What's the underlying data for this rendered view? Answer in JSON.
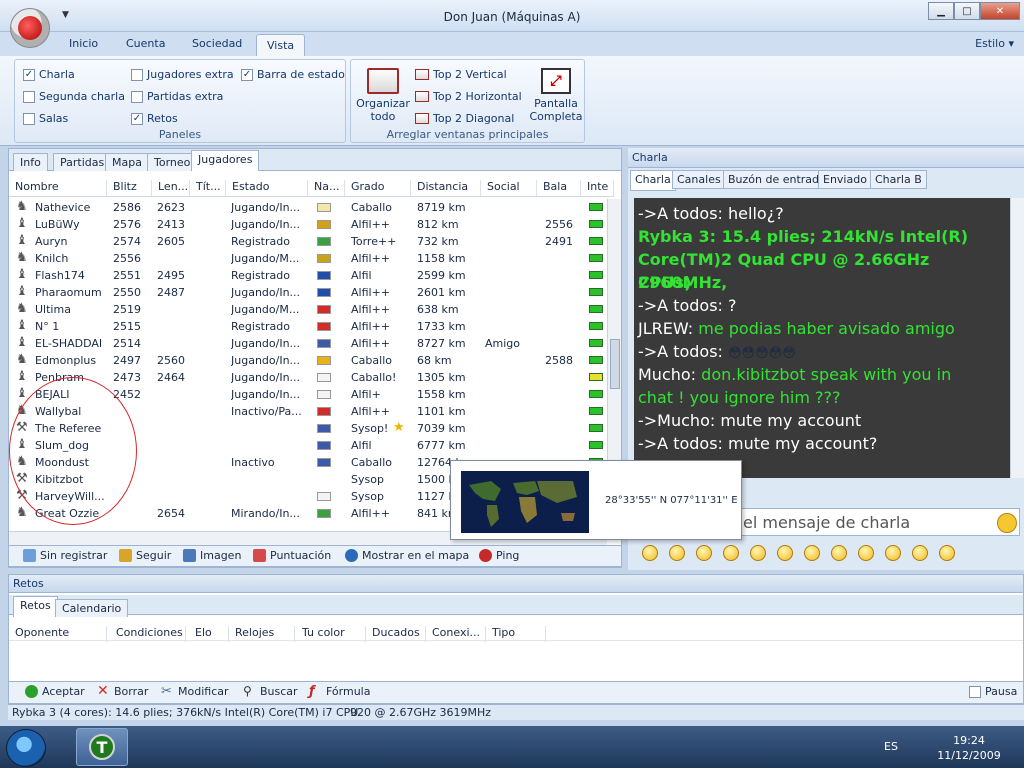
{
  "window": {
    "title": "Don Juan (Máquinas A)"
  },
  "ribbon_tabs": [
    "Inicio",
    "Cuenta",
    "Sociedad",
    "Vista"
  ],
  "estilo_label": "Estilo",
  "paneles": {
    "label": "Paneles",
    "checks": [
      {
        "label": "Charla",
        "checked": true
      },
      {
        "label": "Segunda charla",
        "checked": false
      },
      {
        "label": "Salas",
        "checked": false
      },
      {
        "label": "Jugadores extra",
        "checked": false
      },
      {
        "label": "Partidas extra",
        "checked": false
      },
      {
        "label": "Retos",
        "checked": true
      },
      {
        "label": "Barra de estado",
        "checked": true
      }
    ]
  },
  "arreglar": {
    "label": "Arreglar ventanas principales",
    "organizar": "Organizar todo",
    "top2v": "Top 2 Vertical",
    "top2h": "Top 2 Horizontal",
    "top2d": "Top 2 Diagonal",
    "pantalla": "Pantalla Completa"
  },
  "player_tabs": [
    "Info",
    "Partidas",
    "Mapa",
    "Torneo",
    "Jugadores"
  ],
  "player_columns": [
    "Nombre",
    "Blitz",
    "Len...",
    "Tít...",
    "Estado",
    "Na...",
    "Grado",
    "Distancia",
    "Social",
    "Bala",
    "Inte"
  ],
  "players": [
    {
      "name": "Nathevice",
      "blitz": "2586",
      "len": "2623",
      "estado": "Jugando/In...",
      "grado": "Caballo",
      "dist": "8719 km",
      "social": "",
      "bala": "",
      "flag": "#f5e7a8",
      "lamp": "#2ac12a"
    },
    {
      "name": "LuBüWy",
      "blitz": "2576",
      "len": "2413",
      "estado": "Jugando/In...",
      "grado": "Alfil++",
      "dist": "812 km",
      "social": "",
      "bala": "2556",
      "flag": "#d4a017",
      "lamp": "#2ac12a"
    },
    {
      "name": "Auryn",
      "blitz": "2574",
      "len": "2605",
      "estado": "Registrado",
      "grado": "Torre++",
      "dist": "732 km",
      "social": "",
      "bala": "2491",
      "flag": "#3aa040",
      "lamp": "#2ac12a"
    },
    {
      "name": "Knilch",
      "blitz": "2556",
      "len": "",
      "estado": "Jugando/M...",
      "grado": "Alfil++",
      "dist": "1158 km",
      "social": "",
      "bala": "",
      "flag": "#c9a41a",
      "lamp": "#2ac12a"
    },
    {
      "name": "Flash174",
      "blitz": "2551",
      "len": "2495",
      "estado": "Registrado",
      "grado": "Alfil",
      "dist": "2599 km",
      "social": "",
      "bala": "",
      "flag": "#1f4fa8",
      "lamp": "#2ac12a"
    },
    {
      "name": "Pharaomum",
      "blitz": "2550",
      "len": "2487",
      "estado": "Jugando/In...",
      "grado": "Alfil++",
      "dist": "2601 km",
      "social": "",
      "bala": "",
      "flag": "#1f4fa8",
      "lamp": "#2ac12a"
    },
    {
      "name": "Ultima",
      "blitz": "2519",
      "len": "",
      "estado": "Jugando/M...",
      "grado": "Alfil++",
      "dist": "638 km",
      "social": "",
      "bala": "",
      "flag": "#d42a2a",
      "lamp": "#2ac12a"
    },
    {
      "name": "N° 1",
      "blitz": "2515",
      "len": "",
      "estado": "Registrado",
      "grado": "Alfil++",
      "dist": "1733 km",
      "social": "",
      "bala": "",
      "flag": "#d42a2a",
      "lamp": "#2ac12a"
    },
    {
      "name": "EL-SHADDAI",
      "blitz": "2514",
      "len": "",
      "estado": "Jugando/In...",
      "grado": "Alfil++",
      "dist": "8727 km",
      "social": "Amigo",
      "bala": "",
      "flag": "#3b5aa8",
      "lamp": "#2ac12a"
    },
    {
      "name": "Edmonplus",
      "blitz": "2497",
      "len": "2560",
      "estado": "Jugando/In...",
      "grado": "Caballo",
      "dist": "68 km",
      "social": "",
      "bala": "2588",
      "flag": "#e8b21b",
      "lamp": "#2ac12a"
    },
    {
      "name": "Penbram",
      "blitz": "2473",
      "len": "2464",
      "estado": "Jugando/In...",
      "grado": "Caballo!",
      "dist": "1305 km",
      "social": "",
      "bala": "",
      "flag": "#f4f4f4",
      "lamp": "#e8e02a"
    },
    {
      "name": "BEJALI",
      "blitz": "2452",
      "len": "",
      "estado": "Jugando/In...",
      "grado": "Alfil+",
      "dist": "1558 km",
      "social": "",
      "bala": "",
      "flag": "#f4f4f4",
      "lamp": "#2ac12a"
    },
    {
      "name": "Wallybal",
      "blitz": "",
      "len": "",
      "estado": "Inactivo/Pa...",
      "grado": "Alfil++",
      "dist": "1101 km",
      "social": "",
      "bala": "",
      "flag": "#d42a2a",
      "lamp": "#2ac12a"
    },
    {
      "name": "The Referee",
      "blitz": "",
      "len": "",
      "estado": "",
      "grado": "Sysop!",
      "dist": "7039 km",
      "social": "",
      "bala": "",
      "flag": "#3b5aa8",
      "lamp": "#2ac12a"
    },
    {
      "name": "Slum_dog",
      "blitz": "",
      "len": "",
      "estado": "",
      "grado": "Alfil",
      "dist": "6777 km",
      "social": "",
      "bala": "",
      "flag": "#3b5aa8",
      "lamp": "#2ac12a"
    },
    {
      "name": "Moondust",
      "blitz": "",
      "len": "",
      "estado": "Inactivo",
      "grado": "Caballo",
      "dist": "12764 km",
      "social": "",
      "bala": "",
      "flag": "#3b5aa8",
      "lamp": "#2ac12a"
    },
    {
      "name": "Kibitzbot",
      "blitz": "",
      "len": "",
      "estado": "",
      "grado": "Sysop",
      "dist": "1500 km",
      "social": "",
      "bala": "",
      "flag": "",
      "lamp": "#2ac12a"
    },
    {
      "name": "HarveyWill...",
      "blitz": "",
      "len": "",
      "estado": "",
      "grado": "Sysop",
      "dist": "1127 km",
      "social": "",
      "bala": "",
      "flag": "#f4f4f4",
      "lamp": "#2ac12a"
    },
    {
      "name": "Great Ozzie",
      "blitz": "",
      "len": "2654",
      "estado": "Mirando/In...",
      "grado": "Alfil++",
      "dist": "841 km",
      "social": "",
      "bala": "",
      "flag": "#3aa040",
      "lamp": "#2ac12a"
    }
  ],
  "player_toolbar": [
    "Sin registrar",
    "Seguir",
    "Imagen",
    "Puntuación",
    "Mostrar en el mapa",
    "Ping"
  ],
  "map_popup": {
    "coords": "28°33'55'' N  077°11'31'' E"
  },
  "chat": {
    "title": "Charla",
    "tabs": [
      "Charla",
      "Canales",
      "Buzón de entrada",
      "Enviado",
      "Charla B"
    ],
    "input_placeholder": "el mensaje de charla"
  },
  "chat_lines": [
    {
      "prefix": "",
      "text": "->A todos: hello¿?",
      "style": "white"
    },
    {
      "prefix": "",
      "text": "Rybka 3: 15.4 plies; 214kN/s Intel(R)",
      "style": "green"
    },
    {
      "prefix": "",
      "text": "Core(TM)2 Quad CPU @ 2.66GHz 2960MHz,",
      "style": "green"
    },
    {
      "prefix": "",
      "text": "CPUs)",
      "style": "green"
    },
    {
      "prefix": "",
      "text": "->A todos: ?",
      "style": "white"
    },
    {
      "prefix": "JLREW:",
      "text": "me podias haber avisado amigo",
      "style": "mixed"
    },
    {
      "prefix": "",
      "text": "->A todos:",
      "style": "white"
    },
    {
      "prefix": "Mucho:",
      "text": "don.kibitzbot speak with you in",
      "style": "mixed"
    },
    {
      "prefix": "",
      "text": "chat ! you ignore him ???",
      "style": "greenb"
    },
    {
      "prefix": "",
      "text": "->Mucho: mute my account",
      "style": "white"
    },
    {
      "prefix": "",
      "text": "->A todos: mute my account?",
      "style": "white"
    }
  ],
  "retos": {
    "title": "Retos",
    "tabs": [
      "Retos",
      "Calendario"
    ],
    "columns": [
      "Oponente",
      "Condiciones",
      "Elo",
      "Relojes",
      "Tu color",
      "Ducados",
      "Conexi...",
      "Tipo"
    ],
    "toolbar": [
      "Aceptar",
      "Borrar",
      "Modificar",
      "Buscar",
      "Fórmula"
    ],
    "pausa": "Pausa"
  },
  "status": {
    "engine": "Rybka 3 (4 cores): 14.6 plies; 376kN/s Intel(R) Core(TM) i7 CPU",
    "extra": "920  @ 2.67GHz 3619MHz"
  },
  "taskbar": {
    "lang": "ES",
    "time": "19:24",
    "date": "11/12/2009"
  }
}
